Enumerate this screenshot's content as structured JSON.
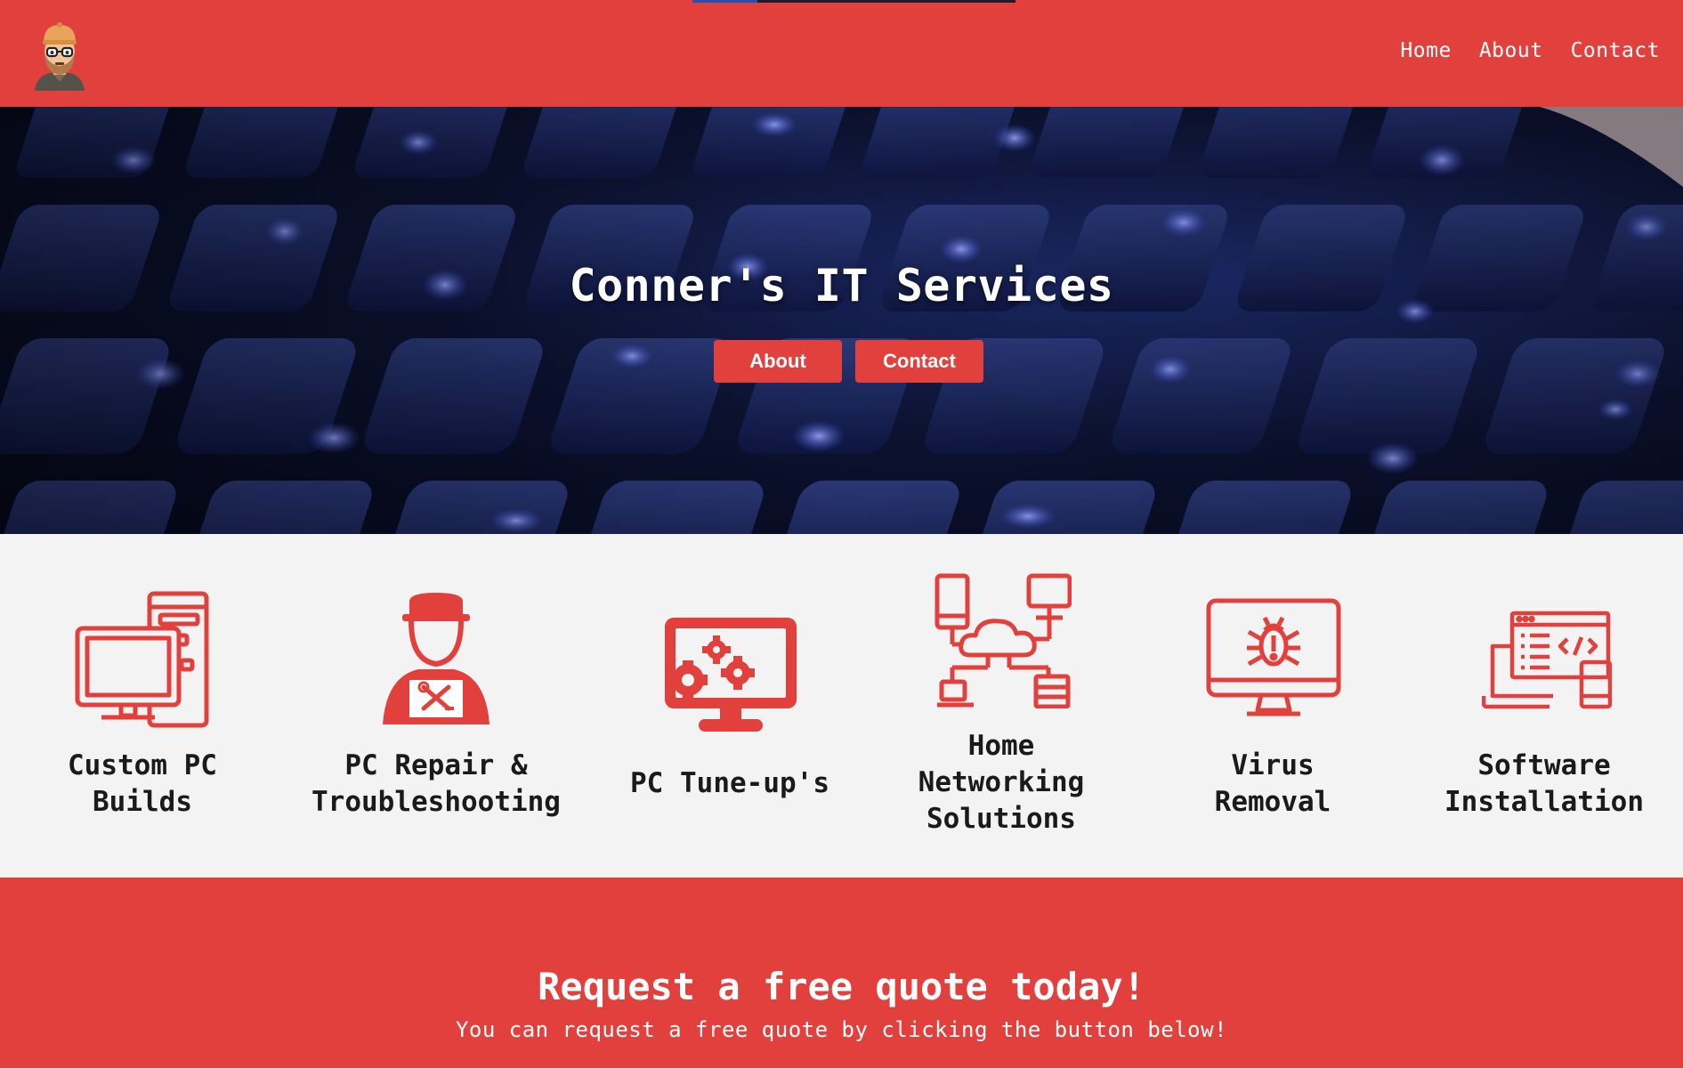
{
  "header": {
    "logo_alt": "Conner avatar logo",
    "nav": [
      {
        "label": "Home"
      },
      {
        "label": "About"
      },
      {
        "label": "Contact"
      }
    ]
  },
  "hero": {
    "title": "Conner's IT Services",
    "buttons": [
      {
        "label": "About"
      },
      {
        "label": "Contact"
      }
    ],
    "background": "keyboard-photo"
  },
  "services": [
    {
      "label_lines": [
        "Custom PC",
        "Builds"
      ],
      "icon": "desktop-tower-icon"
    },
    {
      "label_lines": [
        "PC Repair &",
        "Troubleshooting"
      ],
      "icon": "technician-icon"
    },
    {
      "label_lines": [
        "PC Tune-up's"
      ],
      "icon": "monitor-gears-icon"
    },
    {
      "label_lines": [
        "Home",
        "Networking",
        "Solutions"
      ],
      "icon": "cloud-network-icon"
    },
    {
      "label_lines": [
        "Virus",
        "Removal"
      ],
      "icon": "monitor-bug-icon"
    },
    {
      "label_lines": [
        "Software",
        "Installation"
      ],
      "icon": "laptop-code-icon"
    }
  ],
  "quote": {
    "title": "Request a free quote today!",
    "subtitle": "You can request a free quote by clicking the button below!"
  },
  "colors": {
    "brand_red": "#e2403c",
    "services_bg": "#f3f3f3",
    "text_dark": "#1a1a1a",
    "white": "#ffffff"
  },
  "page_progress": 0.2
}
